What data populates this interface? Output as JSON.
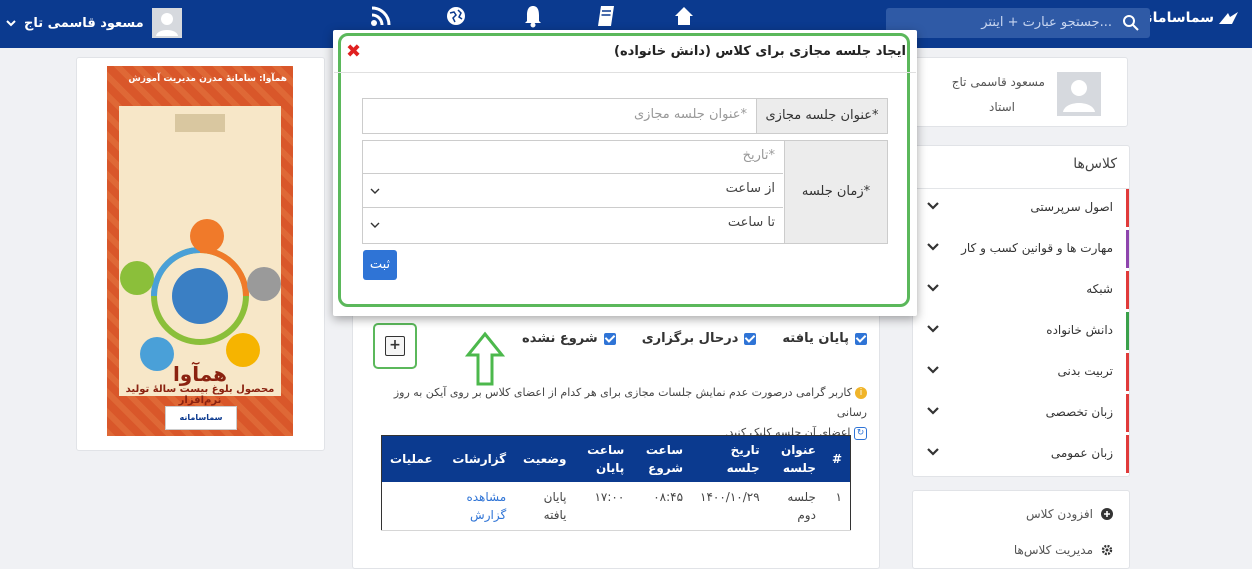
{
  "topbar": {
    "brand": "سماسامانه",
    "search_placeholder": "جستجو عبارت + اینتر...",
    "user_name": "مسعود قاسمی تاج",
    "nav_icons": [
      "rss-icon",
      "globe-icon",
      "bell-icon",
      "book-icon",
      "home-icon"
    ]
  },
  "profile": {
    "name": "مسعود قاسمی تاج",
    "role": "استاد"
  },
  "classes": {
    "heading": "کلاس‌ها",
    "items": [
      {
        "label": "اصول سرپرستی",
        "color": "#e03a3a"
      },
      {
        "label": "مهارت ها و قوانین کسب و کار",
        "color": "#8e44ad"
      },
      {
        "label": "شبکه",
        "color": "#e03a3a"
      },
      {
        "label": "دانش خانواده",
        "color": "#3aa04a"
      },
      {
        "label": "تربیت بدنی",
        "color": "#e03a3a"
      },
      {
        "label": "زبان تخصصی",
        "color": "#e03a3a"
      },
      {
        "label": "زبان عمومی",
        "color": "#e03a3a"
      }
    ],
    "add_class": "افزودن کلاس",
    "manage_classes": "مدیریت کلاس‌ها"
  },
  "poster": {
    "top_text": "همآوا: سامانهٔ مدرن مدیریت آموزش",
    "title": "همآوا",
    "subtitle": "محصول بلوغ بیست سالهٔ تولید نرم‌افزار",
    "logo": "سماسامانه"
  },
  "modal": {
    "title": "ایجاد جلسه مجازی برای کلاس (دانش خانواده)",
    "session_title_label": "عنوان جلسه مجازی*",
    "session_title_placeholder": "عنوان جلسه مجازی*",
    "session_time_label": "زمان جلسه*",
    "date_placeholder": "تاریخ*",
    "from_hour": "از ساعت",
    "to_hour": "تا ساعت",
    "submit": "ثبت"
  },
  "filters": {
    "not_started": "شروع نشده",
    "in_progress": "درحال برگزاری",
    "finished": "پایان یافته"
  },
  "note": {
    "text1": "کاربر گرامی درصورت عدم نمایش جلسات مجازی برای هر کدام از اعضای کلاس بر روی آیکن به روز رسانی",
    "text2": "اعضای آن جلسه کلیک کنید."
  },
  "table": {
    "headers": [
      "#",
      "عنوان جلسه",
      "تاریخ جلسه",
      "ساعت شروع",
      "ساعت پایان",
      "وضعیت",
      "گزارشات",
      "عملیات"
    ],
    "rows": [
      {
        "num": "۱",
        "title": "جلسه دوم",
        "date": "۱۴۰۰/۱۰/۲۹",
        "start": "۰۸:۴۵",
        "end": "۱۷:۰۰",
        "status": "پایان یافته",
        "report": "مشاهده گزارش",
        "ops": ""
      }
    ]
  }
}
